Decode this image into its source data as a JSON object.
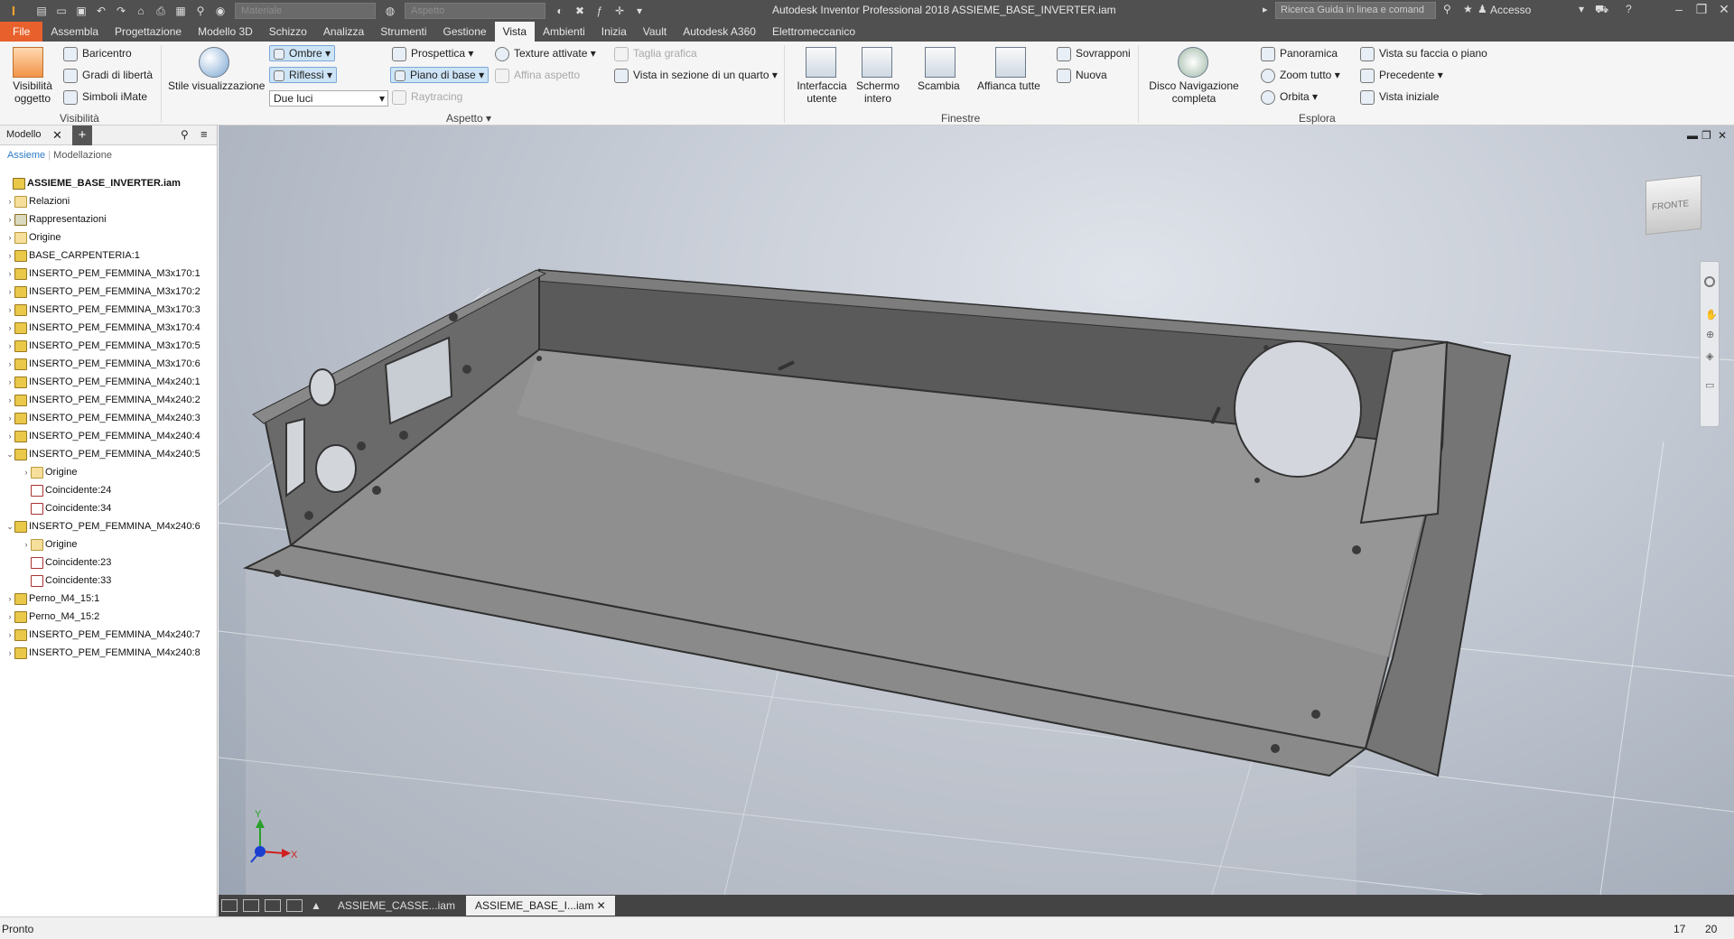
{
  "app": {
    "logo_text": "I",
    "title": "Autodesk Inventor Professional 2018    ASSIEME_BASE_INVERTER.iam",
    "help_search_placeholder": "Ricerca Guida in linea e comand",
    "account_label": "Accesso",
    "quick_access": {
      "material_placeholder": "Materiale",
      "appearance_placeholder": "Aspetto"
    }
  },
  "tabs": [
    "File",
    "Assembla",
    "Progettazione",
    "Modello 3D",
    "Schizzo",
    "Analizza",
    "Strumenti",
    "Gestione",
    "Vista",
    "Ambienti",
    "Inizia",
    "Vault",
    "Autodesk A360",
    "Elettromeccanico"
  ],
  "active_tab": "Vista",
  "ribbon": {
    "visibility": {
      "big_button": "Visibilità oggetto",
      "items": [
        "Baricentro",
        "Gradi di libertà",
        "Simboli iMate"
      ],
      "panel_label": "Visibilità"
    },
    "appearance": {
      "style_button": "Stile visualizzazione",
      "shading": "Ombre",
      "reflections": "Riflessi",
      "lighting": "Due luci",
      "perspective": "Prospettica",
      "ground_plane": "Piano di base",
      "raytracing": "Raytracing",
      "textures": "Texture attivate",
      "refine": "Affina aspetto",
      "section_cut": "Taglia grafica",
      "quarter_section": "Vista in sezione di un quarto",
      "panel_label": "Aspetto"
    },
    "windows": {
      "user_interface": "Interfaccia utente",
      "full_screen": "Schermo intero",
      "switch": "Scambia",
      "tile_all": "Affianca tutte",
      "cascade": "Sovrapponi",
      "new": "Nuova",
      "panel_label": "Finestre"
    },
    "navigate": {
      "nav_wheel": "Disco Navigazione completa",
      "pan": "Panoramica",
      "zoom_all": "Zoom tutto",
      "orbit": "Orbita",
      "look_at": "Vista su faccia o piano",
      "previous": "Precedente",
      "home": "Vista iniziale",
      "panel_label": "Esplora"
    }
  },
  "browser": {
    "tab": "Modello",
    "modes": [
      "Assieme",
      "Modellazione"
    ],
    "tree": [
      {
        "label": "ASSIEME_BASE_INVERTER.iam",
        "level": 0,
        "type": "asm",
        "toggle": ""
      },
      {
        "label": "Relazioni",
        "level": 1,
        "type": "folder",
        "toggle": "›"
      },
      {
        "label": "Rappresentazioni",
        "level": 1,
        "type": "rep",
        "toggle": "›"
      },
      {
        "label": "Origine",
        "level": 1,
        "type": "folder",
        "toggle": "›"
      },
      {
        "label": "BASE_CARPENTERIA:1",
        "level": 1,
        "type": "part",
        "toggle": "›"
      },
      {
        "label": "INSERTO_PEM_FEMMINA_M3x170:1",
        "level": 1,
        "type": "part",
        "toggle": "›"
      },
      {
        "label": "INSERTO_PEM_FEMMINA_M3x170:2",
        "level": 1,
        "type": "part",
        "toggle": "›"
      },
      {
        "label": "INSERTO_PEM_FEMMINA_M3x170:3",
        "level": 1,
        "type": "part",
        "toggle": "›"
      },
      {
        "label": "INSERTO_PEM_FEMMINA_M3x170:4",
        "level": 1,
        "type": "part",
        "toggle": "›"
      },
      {
        "label": "INSERTO_PEM_FEMMINA_M3x170:5",
        "level": 1,
        "type": "part",
        "toggle": "›"
      },
      {
        "label": "INSERTO_PEM_FEMMINA_M3x170:6",
        "level": 1,
        "type": "part",
        "toggle": "›"
      },
      {
        "label": "INSERTO_PEM_FEMMINA_M4x240:1",
        "level": 1,
        "type": "part",
        "toggle": "›"
      },
      {
        "label": "INSERTO_PEM_FEMMINA_M4x240:2",
        "level": 1,
        "type": "part",
        "toggle": "›"
      },
      {
        "label": "INSERTO_PEM_FEMMINA_M4x240:3",
        "level": 1,
        "type": "part",
        "toggle": "›"
      },
      {
        "label": "INSERTO_PEM_FEMMINA_M4x240:4",
        "level": 1,
        "type": "part",
        "toggle": "›"
      },
      {
        "label": "INSERTO_PEM_FEMMINA_M4x240:5",
        "level": 1,
        "type": "part",
        "toggle": "⌄"
      },
      {
        "label": "Origine",
        "level": 2,
        "type": "folder",
        "toggle": "›"
      },
      {
        "label": "Coincidente:24",
        "level": 2,
        "type": "rel",
        "toggle": ""
      },
      {
        "label": "Coincidente:34",
        "level": 2,
        "type": "rel",
        "toggle": ""
      },
      {
        "label": "INSERTO_PEM_FEMMINA_M4x240:6",
        "level": 1,
        "type": "part",
        "toggle": "⌄"
      },
      {
        "label": "Origine",
        "level": 2,
        "type": "folder",
        "toggle": "›"
      },
      {
        "label": "Coincidente:23",
        "level": 2,
        "type": "rel",
        "toggle": ""
      },
      {
        "label": "Coincidente:33",
        "level": 2,
        "type": "rel",
        "toggle": ""
      },
      {
        "label": "Perno_M4_15:1",
        "level": 1,
        "type": "part",
        "toggle": "›"
      },
      {
        "label": "Perno_M4_15:2",
        "level": 1,
        "type": "part",
        "toggle": "›"
      },
      {
        "label": "INSERTO_PEM_FEMMINA_M4x240:7",
        "level": 1,
        "type": "part",
        "toggle": "›"
      },
      {
        "label": "INSERTO_PEM_FEMMINA_M4x240:8",
        "level": 1,
        "type": "part",
        "toggle": "›"
      }
    ]
  },
  "viewcube_label": "FRONTE",
  "axes": {
    "x": "X",
    "y": "Y"
  },
  "doc_tabs": [
    "ASSIEME_CASSE...iam",
    "ASSIEME_BASE_I...iam"
  ],
  "active_doc": "ASSIEME_BASE_I...iam",
  "status": {
    "message": "Pronto",
    "count1": "17",
    "count2": "20"
  },
  "colors": {
    "accent": "#e8612c",
    "titlebar": "#505050",
    "highlight": "#cde4f7"
  }
}
